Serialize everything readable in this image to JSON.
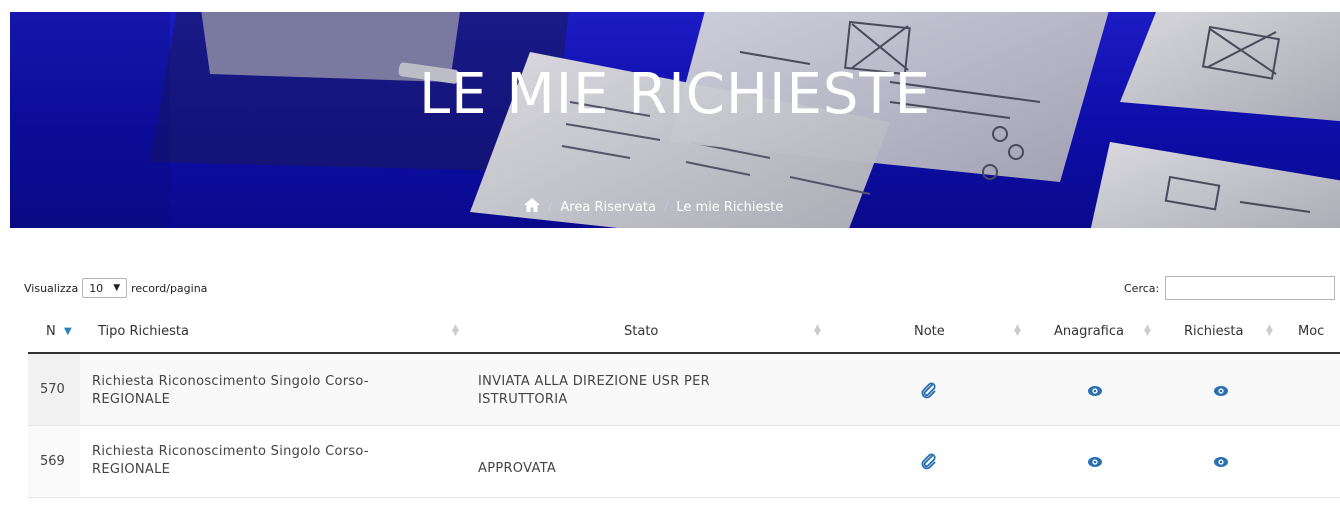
{
  "hero": {
    "title": "LE MIE RICHIESTE",
    "breadcrumb": {
      "home_icon": "home-icon",
      "separator": "/",
      "items": [
        "Area Riservata",
        "Le mie Richieste"
      ]
    }
  },
  "controls": {
    "show_label": "Visualizza",
    "page_size": "10",
    "records_label": "record/pagina",
    "search_label": "Cerca:",
    "search_value": ""
  },
  "table": {
    "columns": [
      "N",
      "Tipo Richiesta",
      "Stato",
      "Note",
      "Anagrafica",
      "Richiesta",
      "Moc"
    ],
    "rows": [
      {
        "n": "570",
        "tipo_line1": "Richiesta Riconoscimento Singolo Corso-",
        "tipo_line2": "REGIONALE",
        "stato_line1": "INVIATA ALLA DIREZIONE USR PER",
        "stato_line2": "ISTRUTTORIA",
        "note_icon": "paperclip-icon",
        "anagrafica_icon": "eye-icon",
        "richiesta_icon": "eye-icon"
      },
      {
        "n": "569",
        "tipo_line1": "Richiesta Riconoscimento Singolo Corso-",
        "tipo_line2": "REGIONALE",
        "stato_line1": "APPROVATA",
        "stato_line2": "",
        "note_icon": "paperclip-icon",
        "anagrafica_icon": "eye-icon",
        "richiesta_icon": "eye-icon"
      }
    ]
  },
  "colors": {
    "hero_blue": "#1414b8",
    "icon_blue": "#2a6fb0",
    "sort_active": "#2a7fc0"
  }
}
